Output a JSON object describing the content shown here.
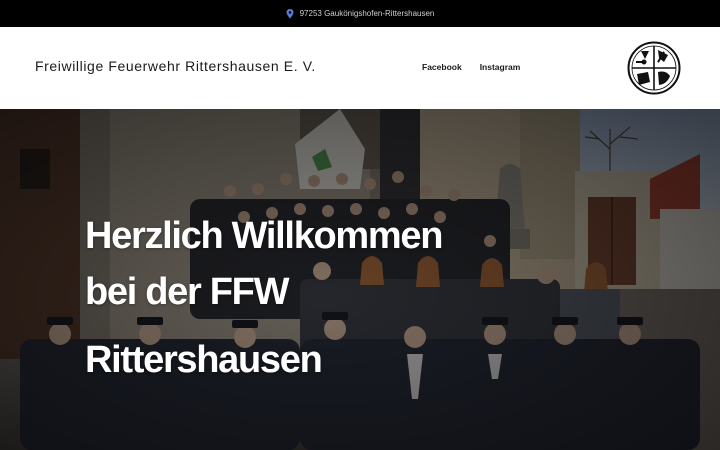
{
  "topbar": {
    "address": "97253 Gaukönigshofen-Rittershausen",
    "icon": "location-pin-icon"
  },
  "header": {
    "site_title": "Freiwillige Feuerwehr Rittershausen E. V.",
    "nav": [
      {
        "label": "Facebook"
      },
      {
        "label": "Instagram"
      }
    ],
    "logo_icon": "fire-brigade-emblem-icon"
  },
  "hero": {
    "heading_line1": "Herzlich Willkommen",
    "heading_line2": "bei der FFW",
    "heading_line3": "Rittershausen",
    "image": "group-photo-fire-brigade-members"
  },
  "colors": {
    "topbar_bg": "#000000",
    "header_bg": "#ffffff",
    "pin_accent": "#5b7bd5",
    "hero_text": "#ffffff"
  }
}
